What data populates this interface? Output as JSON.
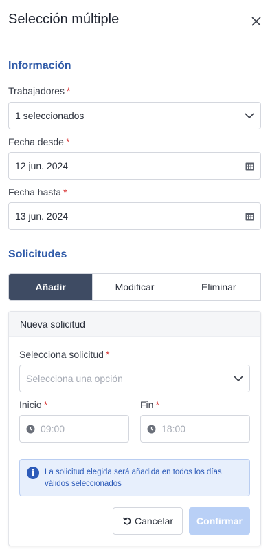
{
  "header": {
    "title": "Selección múltiple",
    "close_icon": "close-icon"
  },
  "info_section": {
    "title": "Información",
    "workers": {
      "label": "Trabajadores",
      "required": "*",
      "value": "1 seleccionados"
    },
    "date_from": {
      "label": "Fecha desde",
      "required": "*",
      "value": "12 jun. 2024"
    },
    "date_to": {
      "label": "Fecha hasta",
      "required": "*",
      "value": "13 jun. 2024"
    }
  },
  "requests_section": {
    "title": "Solicitudes",
    "tabs": [
      {
        "label": "Añadir",
        "active": true
      },
      {
        "label": "Modificar",
        "active": false
      },
      {
        "label": "Eliminar",
        "active": false
      }
    ]
  },
  "new_request": {
    "title": "Nueva solicitud",
    "select": {
      "label": "Selecciona solicitud",
      "required": "*",
      "placeholder": "Selecciona una opción"
    },
    "start": {
      "label": "Inicio",
      "required": "*",
      "placeholder": "09:00"
    },
    "end": {
      "label": "Fin",
      "required": "*",
      "placeholder": "18:00"
    },
    "info_message": "La solicitud elegida será añadida en todos los días válidos seleccionados",
    "cancel_label": "Cancelar",
    "confirm_label": "Confirmar"
  },
  "colors": {
    "accent": "#2f5aa8",
    "active_tab": "#3e4b63",
    "required": "#d93636",
    "info_bg": "#e7effc",
    "confirm_disabled": "#b9d0f6"
  }
}
